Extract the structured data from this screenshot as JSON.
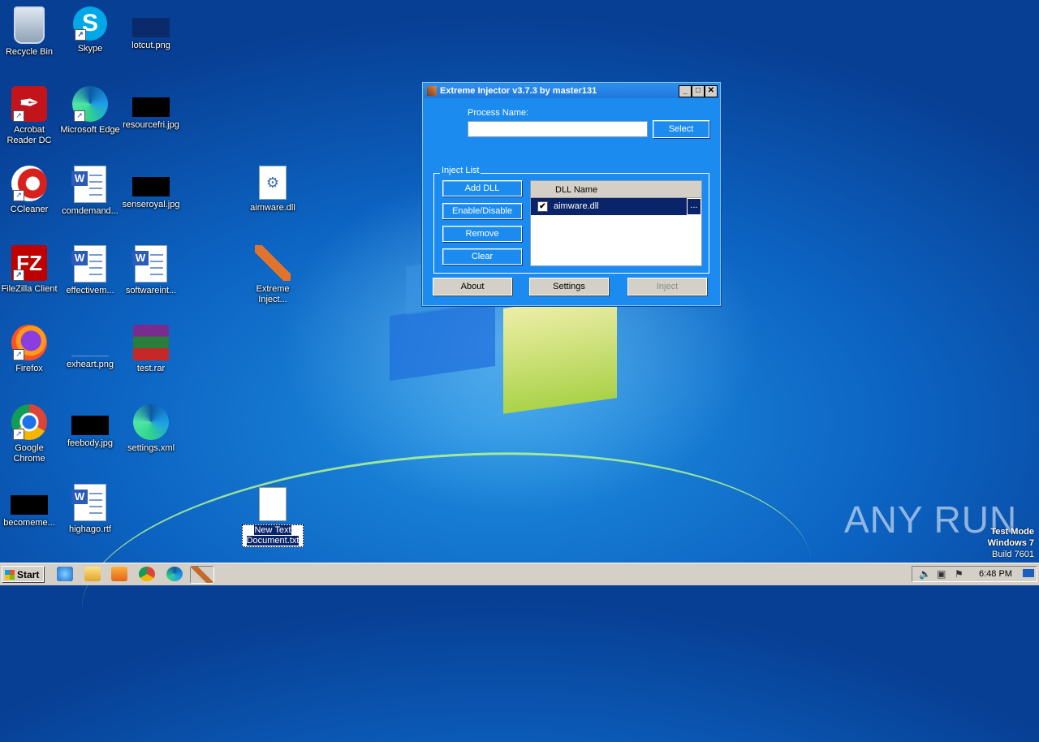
{
  "desktop": {
    "icons": [
      {
        "label": "Recycle Bin"
      },
      {
        "label": "Skype"
      },
      {
        "label": "lotcut.png"
      },
      {
        "label": "Acrobat Reader DC"
      },
      {
        "label": "Microsoft Edge"
      },
      {
        "label": "resourcefri.jpg"
      },
      {
        "label": "CCleaner"
      },
      {
        "label": "comdemand..."
      },
      {
        "label": "senseroyal.jpg"
      },
      {
        "label": "aimware.dll"
      },
      {
        "label": "FileZilla Client"
      },
      {
        "label": "effectivem..."
      },
      {
        "label": "softwareint..."
      },
      {
        "label": "Extreme Inject..."
      },
      {
        "label": "Firefox"
      },
      {
        "label": "exheart.png"
      },
      {
        "label": "test.rar"
      },
      {
        "label": "Google Chrome"
      },
      {
        "label": "feebody.jpg"
      },
      {
        "label": "settings.xml"
      },
      {
        "label": "becomeme..."
      },
      {
        "label": "highago.rtf"
      },
      {
        "label": "New Text Document.txt"
      }
    ]
  },
  "window": {
    "title": "Extreme Injector v3.7.3 by master131",
    "minimize": "_",
    "maximize": "□",
    "close": "✕",
    "process_label": "Process Name:",
    "process_value": "",
    "select_button": "Select",
    "inject_list_label": "Inject List",
    "add_dll": "Add DLL",
    "enable_disable": "Enable/Disable",
    "remove": "Remove",
    "clear": "Clear",
    "list_header": "DLL Name",
    "dll_rows": [
      {
        "name": "aimware.dll",
        "checked": true,
        "more": "..."
      }
    ],
    "about": "About",
    "settings": "Settings",
    "inject": "Inject"
  },
  "taskbar": {
    "start_label": "Start",
    "clock": "6:48 PM"
  },
  "watermark": "ANY RUN",
  "test_mode": {
    "line1": "Test Mode",
    "line2": "Windows 7",
    "line3": "Build 7601"
  }
}
